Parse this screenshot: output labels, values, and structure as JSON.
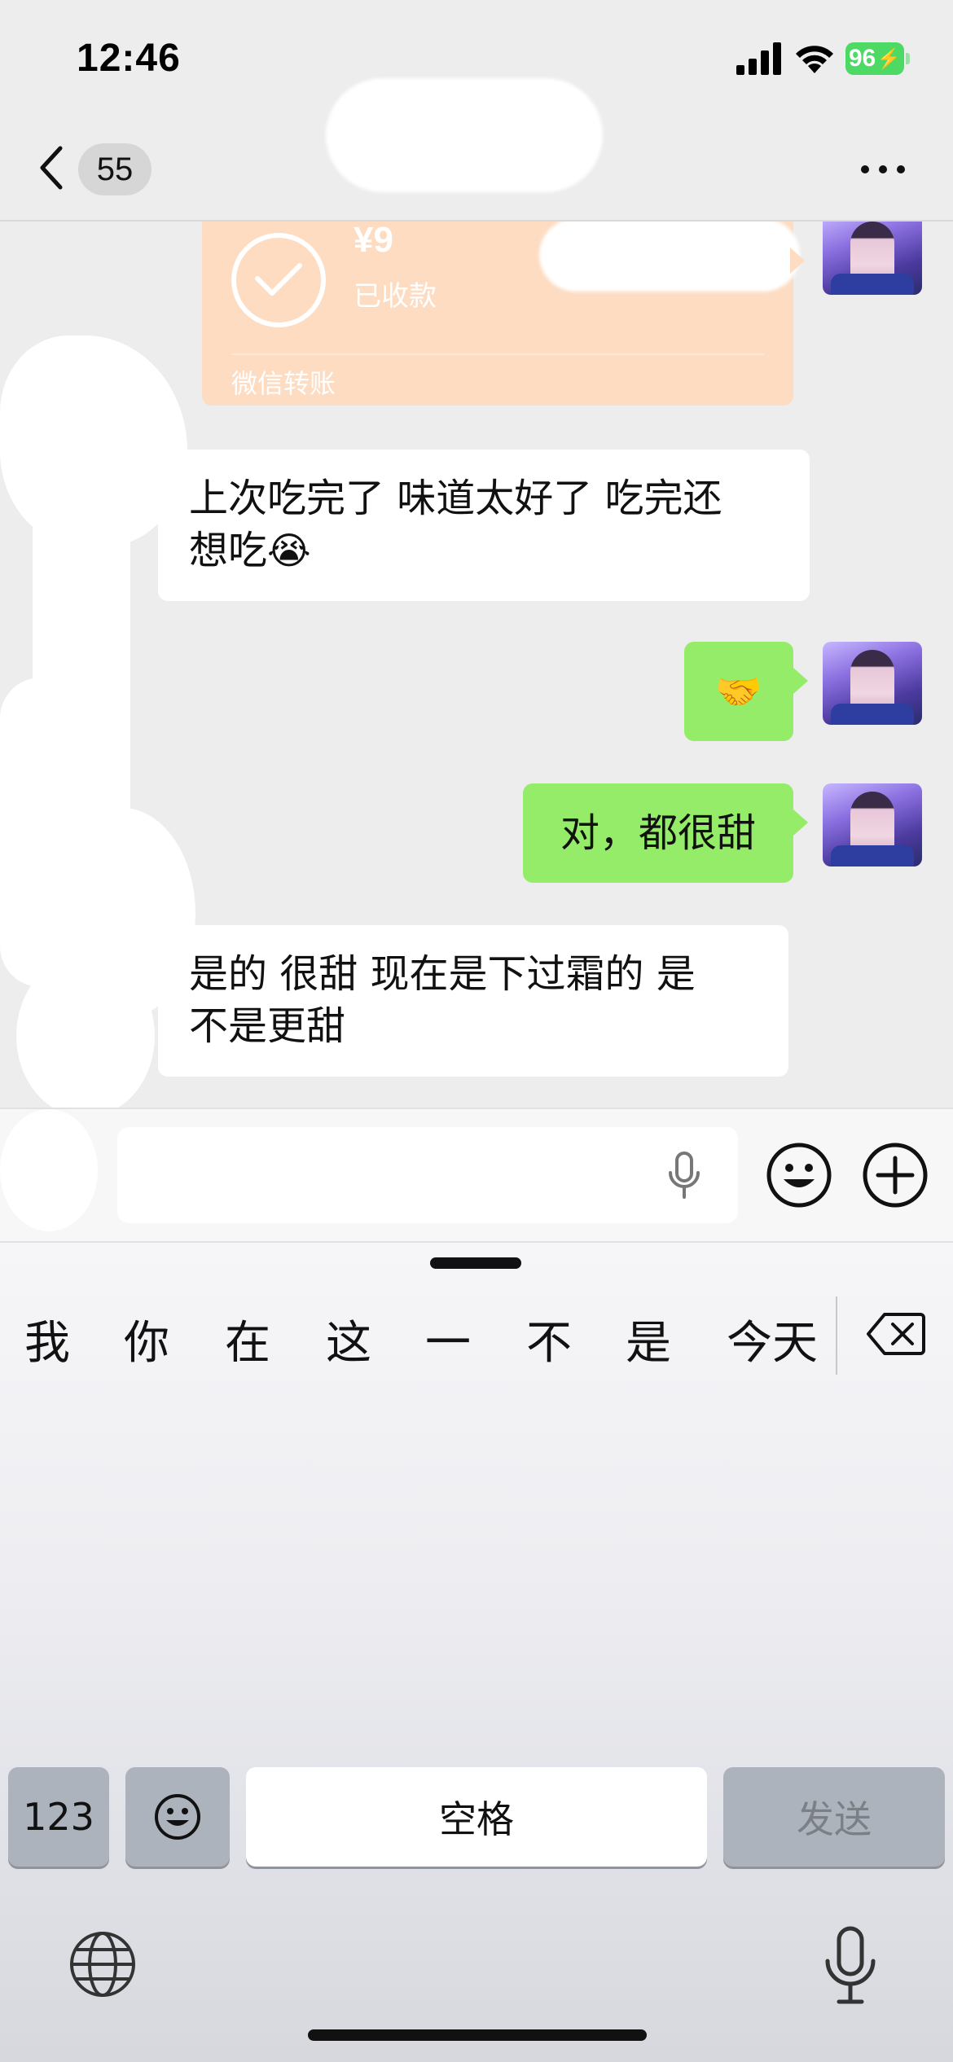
{
  "status_bar": {
    "time": "12:46",
    "battery": "96",
    "battery_color": "#4cd964"
  },
  "nav": {
    "back_icon": "chevron-left-icon",
    "unread_count": "55",
    "more_icon": "ellipsis-icon"
  },
  "messages": [
    {
      "type": "transfer",
      "direction": "out",
      "amount": "¥9",
      "status": "已收款",
      "footer": "微信转账"
    },
    {
      "type": "text",
      "direction": "in",
      "line1": "上次吃完了  味道太好了  吃完还",
      "line2": "想吃",
      "emoji": "😭"
    },
    {
      "type": "emoji",
      "direction": "out",
      "emoji": "🤝"
    },
    {
      "type": "text",
      "direction": "out",
      "text": "对，都很甜"
    },
    {
      "type": "text",
      "direction": "in",
      "line1": "是的  很甜  现在是下过霜的  是",
      "line2": "不是更甜"
    }
  ],
  "input_bar": {
    "voice_icon": "voice-toggle-icon",
    "mic_icon": "microphone-icon",
    "emoji_icon": "smiley-icon",
    "plus_icon": "plus-circle-icon"
  },
  "keyboard": {
    "candidates": [
      "我",
      "你",
      "在",
      "这",
      "一",
      "不",
      "是",
      "今天"
    ],
    "keys": {
      "numbers": "123",
      "space": "空格",
      "send": "发送"
    },
    "colors": {
      "chat_bg": "#ededed",
      "outgoing_bubble": "#95ec69",
      "transfer_card": "#fddcc2"
    }
  }
}
